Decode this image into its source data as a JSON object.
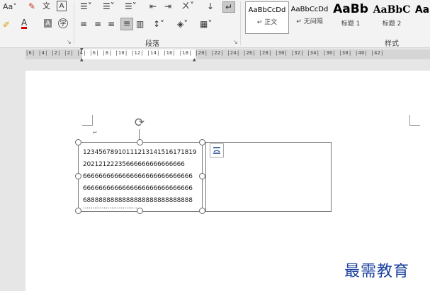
{
  "ribbon": {
    "font": {
      "aa_label": "Aa"
    },
    "paragraph": {
      "group_label": "段落"
    },
    "styles": {
      "group_label": "样式",
      "tiles": [
        {
          "preview": "AaBbCcDd",
          "name": "↵ 正文"
        },
        {
          "preview": "AaBbCcDd",
          "name": "↵ 无间隔"
        },
        {
          "preview": "AaBb",
          "name": "标题 1"
        },
        {
          "preview": "AaBbC",
          "name": "标题 2"
        },
        {
          "preview": "Aa",
          "name": ""
        }
      ]
    }
  },
  "ruler": {
    "text": "|6| |4| |2|   |2| |4| |6| |8| |10| |12| |14| |16| |18| |20| |22| |24| |26| |28| |30| |32| |34| |36| |38| |40| |42|"
  },
  "document": {
    "paragraph_mark": "↵",
    "textbox1_lines": [
      "12345678910111213141516171819",
      "20212122235666666666666666",
      "6666666666666666666666666666",
      "6666666666666666666666666666",
      "6888888888888888888888888888",
      "............................."
    ]
  },
  "watermark": "最需教育"
}
